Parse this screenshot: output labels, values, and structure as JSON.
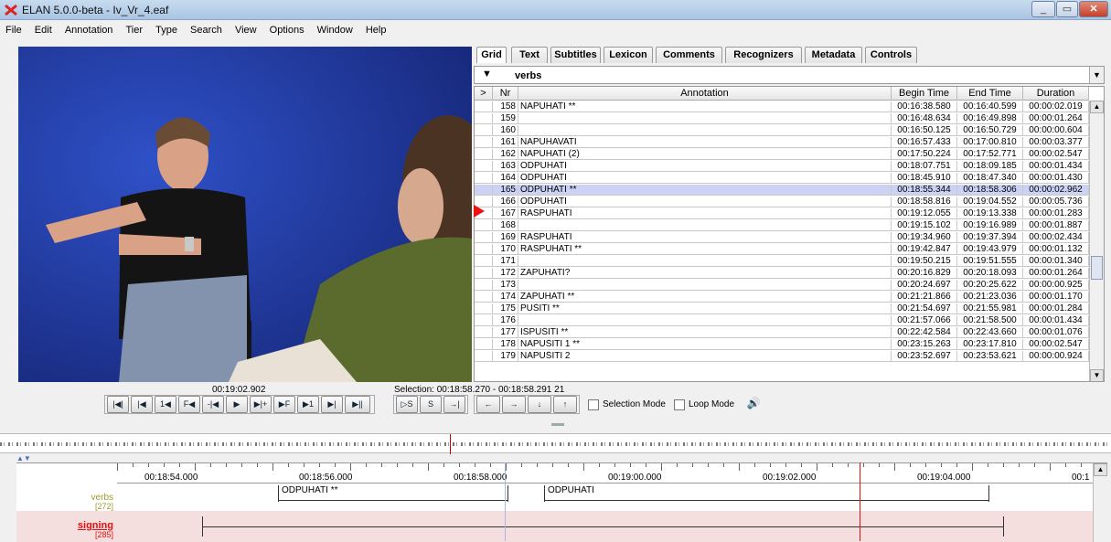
{
  "window": {
    "title": "ELAN 5.0.0-beta - Iv_Vr_4.eaf",
    "controls": [
      "_",
      "▭",
      "✕"
    ]
  },
  "menu": [
    "File",
    "Edit",
    "Annotation",
    "Tier",
    "Type",
    "Search",
    "View",
    "Options",
    "Window",
    "Help"
  ],
  "tabs": [
    "Grid",
    "Text",
    "Subtitles",
    "Lexicon",
    "Comments",
    "Recognizers",
    "Metadata",
    "Controls"
  ],
  "tier_select": {
    "toggle": "▼",
    "value": "verbs",
    "drop": "▼"
  },
  "grid": {
    "columns": {
      "arrow": ">",
      "nr": "Nr",
      "annotation": "Annotation",
      "begin": "Begin Time",
      "end": "End Time",
      "duration": "Duration"
    },
    "rows": [
      {
        "nr": "158",
        "annotation": "NAPUHATI **",
        "begin": "00:16:38.580",
        "end": "00:16:40.599",
        "duration": "00:00:02.019"
      },
      {
        "nr": "159",
        "annotation": "",
        "begin": "00:16:48.634",
        "end": "00:16:49.898",
        "duration": "00:00:01.264"
      },
      {
        "nr": "160",
        "annotation": "",
        "begin": "00:16:50.125",
        "end": "00:16:50.729",
        "duration": "00:00:00.604"
      },
      {
        "nr": "161",
        "annotation": "NAPUHAVATI",
        "begin": "00:16:57.433",
        "end": "00:17:00.810",
        "duration": "00:00:03.377"
      },
      {
        "nr": "162",
        "annotation": "NAPUHATI (2)",
        "begin": "00:17:50.224",
        "end": "00:17:52.771",
        "duration": "00:00:02.547"
      },
      {
        "nr": "163",
        "annotation": "ODPUHATI",
        "begin": "00:18:07.751",
        "end": "00:18:09.185",
        "duration": "00:00:01.434"
      },
      {
        "nr": "164",
        "annotation": "ODPUHATI",
        "begin": "00:18:45.910",
        "end": "00:18:47.340",
        "duration": "00:00:01.430"
      },
      {
        "nr": "165",
        "annotation": "ODPUHATI **",
        "begin": "00:18:55.344",
        "end": "00:18:58.306",
        "duration": "00:00:02.962"
      },
      {
        "nr": "166",
        "annotation": "ODPUHATI",
        "begin": "00:18:58.816",
        "end": "00:19:04.552",
        "duration": "00:00:05.736"
      },
      {
        "nr": "167",
        "annotation": "RASPUHATI",
        "begin": "00:19:12.055",
        "end": "00:19:13.338",
        "duration": "00:00:01.283"
      },
      {
        "nr": "168",
        "annotation": "",
        "begin": "00:19:15.102",
        "end": "00:19:16.989",
        "duration": "00:00:01.887"
      },
      {
        "nr": "169",
        "annotation": "RASPUHATI",
        "begin": "00:19:34.960",
        "end": "00:19:37.394",
        "duration": "00:00:02.434"
      },
      {
        "nr": "170",
        "annotation": "RASPUHATI **",
        "begin": "00:19:42.847",
        "end": "00:19:43.979",
        "duration": "00:00:01.132"
      },
      {
        "nr": "171",
        "annotation": "",
        "begin": "00:19:50.215",
        "end": "00:19:51.555",
        "duration": "00:00:01.340"
      },
      {
        "nr": "172",
        "annotation": "ZAPUHATI?",
        "begin": "00:20:16.829",
        "end": "00:20:18.093",
        "duration": "00:00:01.264"
      },
      {
        "nr": "173",
        "annotation": "",
        "begin": "00:20:24.697",
        "end": "00:20:25.622",
        "duration": "00:00:00.925"
      },
      {
        "nr": "174",
        "annotation": "ZAPUHATI **",
        "begin": "00:21:21.866",
        "end": "00:21:23.036",
        "duration": "00:00:01.170"
      },
      {
        "nr": "175",
        "annotation": "PUŠITI **",
        "begin": "00:21:54.697",
        "end": "00:21:55.981",
        "duration": "00:00:01.284"
      },
      {
        "nr": "176",
        "annotation": "",
        "begin": "00:21:57.066",
        "end": "00:21:58.500",
        "duration": "00:00:01.434"
      },
      {
        "nr": "177",
        "annotation": "ISPUŠITI **",
        "begin": "00:22:42.584",
        "end": "00:22:43.660",
        "duration": "00:00:01.076"
      },
      {
        "nr": "178",
        "annotation": "NAPUŠITI 1 **",
        "begin": "00:23:15.263",
        "end": "00:23:17.810",
        "duration": "00:00:02.547"
      },
      {
        "nr": "179",
        "annotation": "NAPUŠITI 2",
        "begin": "00:23:52.697",
        "end": "00:23:53.621",
        "duration": "00:00:00.924"
      }
    ],
    "selected_nr": "165",
    "current_nr": "166"
  },
  "media": {
    "time": "00:19:02.902",
    "selection": "Selection: 00:18:58.270 - 00:18:58.291  21"
  },
  "transport": [
    "|◀|",
    "|◀",
    "1◀",
    "F◀",
    "-|◀",
    "▶",
    "▶|+",
    "▶F",
    "▶1",
    "▶|",
    "▶||"
  ],
  "selection_controls": [
    "▷S",
    "S",
    "→|"
  ],
  "nav_controls": [
    "←",
    "→",
    "↓",
    "↑"
  ],
  "options": {
    "selection_mode": "Selection Mode",
    "loop_mode": "Loop Mode",
    "volume_icon": "speaker-icon"
  },
  "timeline": {
    "ticks": [
      "00:18:54.000",
      "00:18:56.000",
      "00:18:58.000",
      "00:19:00.000",
      "00:19:02.000",
      "00:19:04.000",
      "00:1"
    ],
    "tiers": [
      {
        "name": "verbs",
        "count": "[272]",
        "color": "#9c9c2a"
      },
      {
        "name": "signing",
        "count": "[285]",
        "color": "#dd1111"
      }
    ],
    "verbs_annotations": [
      "ODPUHATI **",
      "ODPUHATI"
    ]
  }
}
